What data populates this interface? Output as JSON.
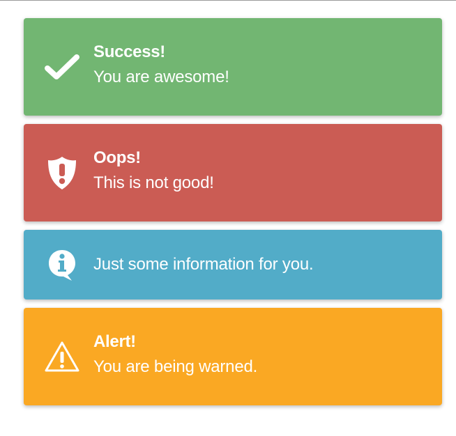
{
  "alerts": [
    {
      "type": "success",
      "icon": "check-icon",
      "color": "#72b672",
      "title": "Success!",
      "message": "You are awesome!"
    },
    {
      "type": "danger",
      "icon": "shield-exclamation-icon",
      "color": "#cb5c54",
      "title": "Oops!",
      "message": "This is not good!"
    },
    {
      "type": "info",
      "icon": "info-bubble-icon",
      "color": "#52acc8",
      "title": "",
      "message": "Just some information for you."
    },
    {
      "type": "warning",
      "icon": "warning-triangle-icon",
      "color": "#faa823",
      "title": "Alert!",
      "message": "You are being warned."
    }
  ]
}
